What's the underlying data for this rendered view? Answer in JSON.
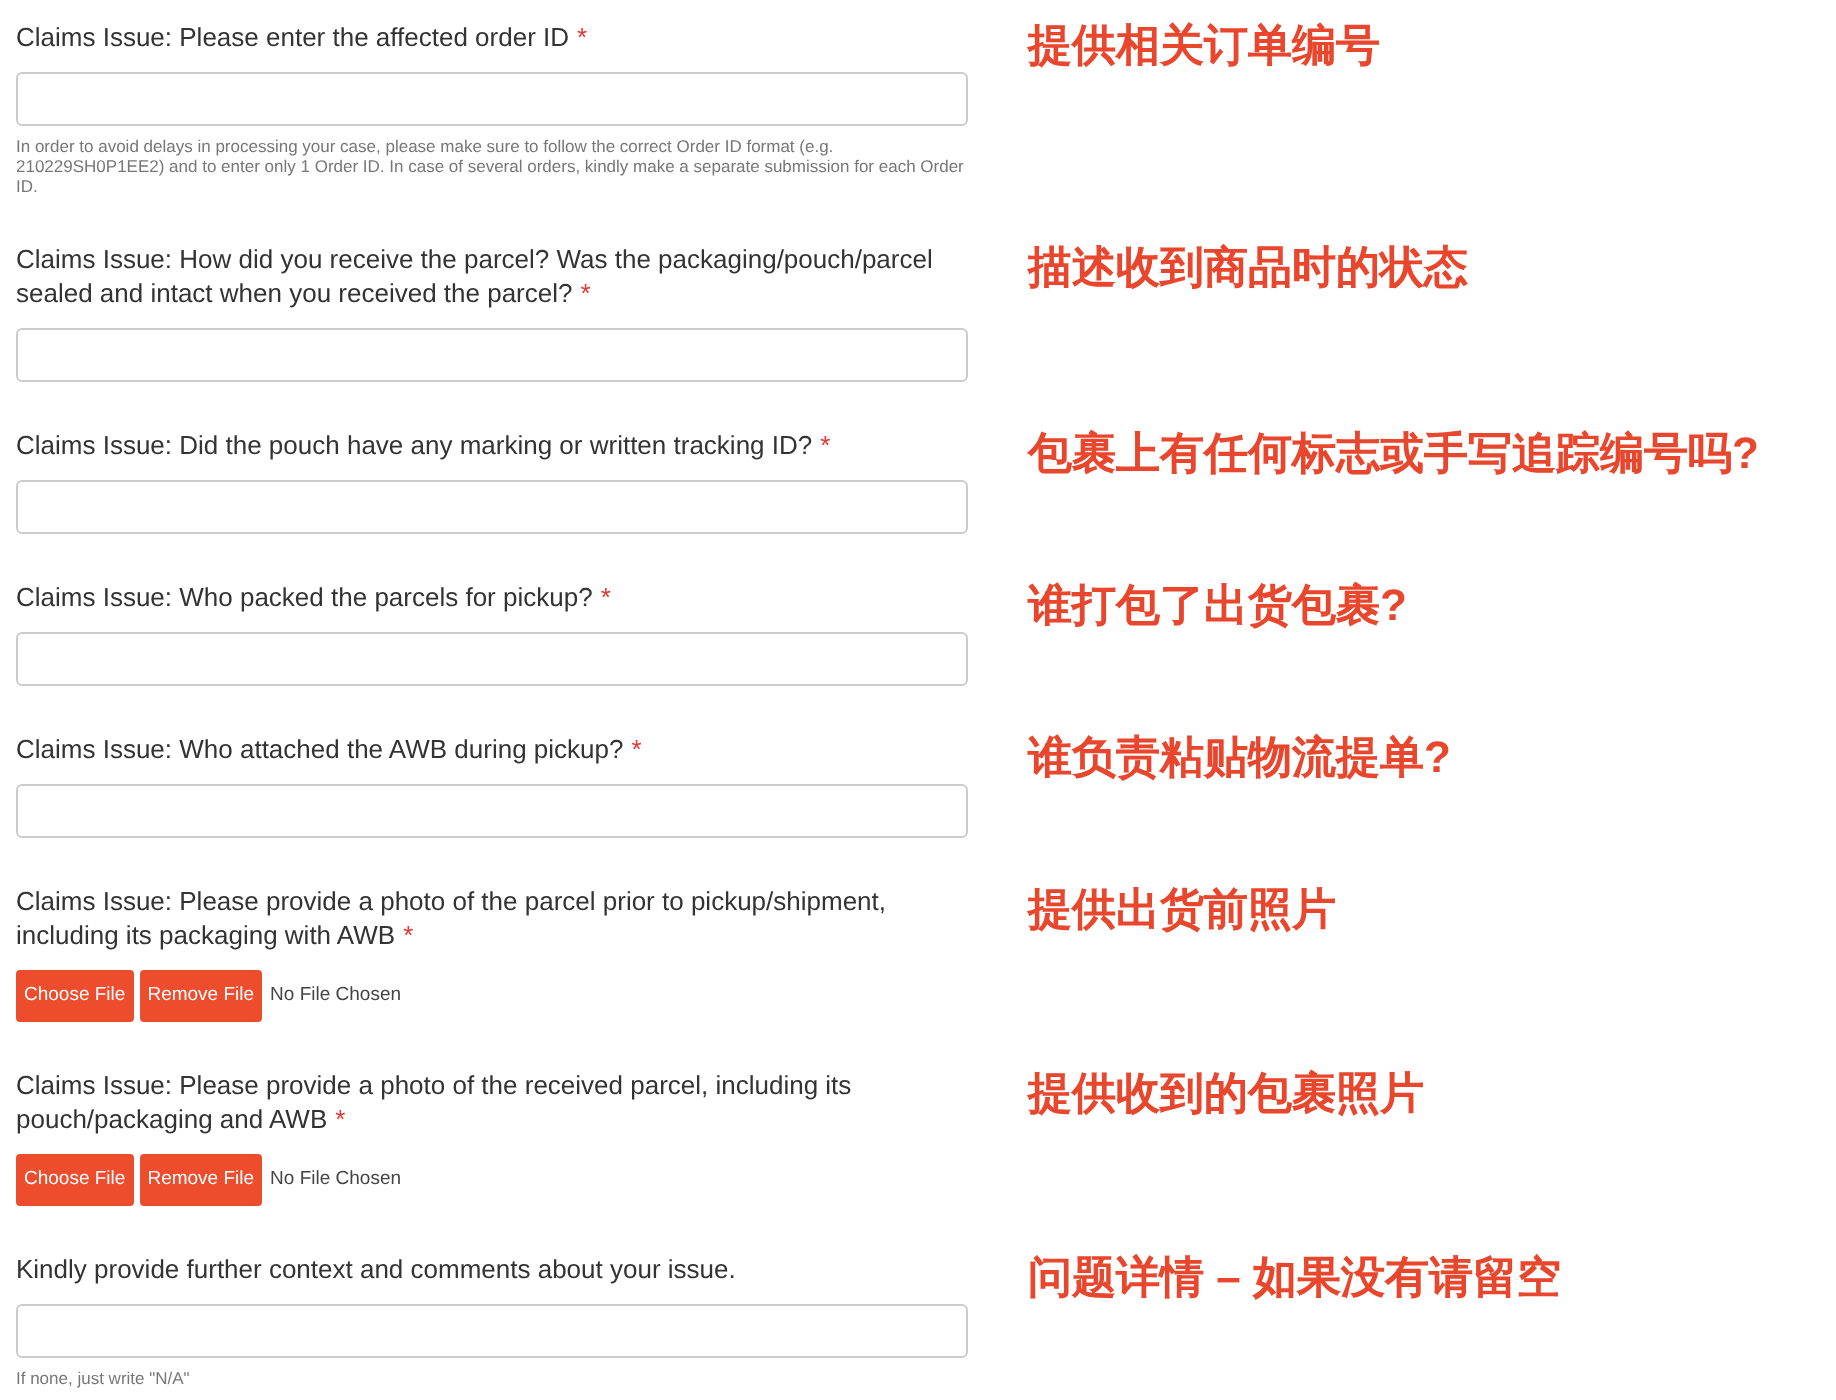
{
  "fields": [
    {
      "kind": "text",
      "label": "Claims Issue: Please enter the affected order ID",
      "asterisk": "*",
      "help": "In order to avoid delays in processing your case, please make sure to follow the correct Order ID format (e.g. 210229SH0P1EE2) and to enter only 1 Order ID. In case of several orders, kindly make a separate submission for each Order ID.",
      "annotation": "提供相关订单编号"
    },
    {
      "kind": "text",
      "label": "Claims Issue: How did you receive the parcel? Was the packaging/pouch/parcel sealed and intact when you received the parcel?",
      "asterisk": "*",
      "annotation": "描述收到商品时的状态"
    },
    {
      "kind": "text",
      "label": "Claims Issue: Did the pouch have any marking or written tracking ID?",
      "asterisk": "*",
      "annotation": "包裹上有任何标志或手写追踪编号吗?"
    },
    {
      "kind": "text",
      "label": "Claims Issue: Who packed the parcels for pickup?",
      "asterisk": "*",
      "annotation": "谁打包了出货包裹?"
    },
    {
      "kind": "text",
      "label": "Claims Issue: Who attached the AWB during pickup?",
      "asterisk": "*",
      "annotation": "谁负责粘贴物流提单?"
    },
    {
      "kind": "file",
      "label": "Claims Issue: Please provide a photo of the parcel prior to pickup/shipment, including its packaging with AWB",
      "asterisk": "*",
      "buttons": [
        "Choose File",
        "Remove File"
      ],
      "file_status": "No File Chosen",
      "annotation": "提供出货前照片"
    },
    {
      "kind": "file",
      "label": "Claims Issue: Please provide a photo of the received parcel, including its pouch/packaging and AWB",
      "asterisk": "*",
      "buttons": [
        "Choose File",
        "Remove File"
      ],
      "file_status": "No File Chosen",
      "annotation": "提供收到的包裹照片"
    },
    {
      "kind": "text",
      "label": "Kindly provide further context and comments about your issue.",
      "help": "If none, just write \"N/A\"",
      "annotation": "问题详情 – 如果没有请留空"
    }
  ]
}
